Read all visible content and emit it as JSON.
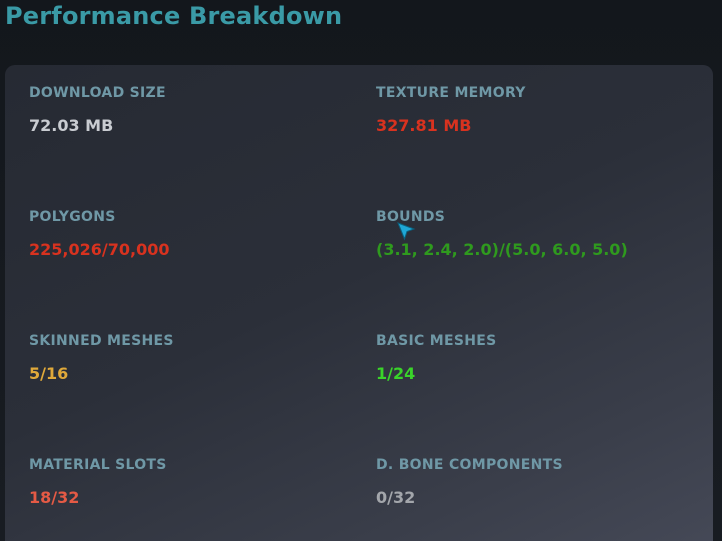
{
  "header": {
    "title": "Performance Breakdown"
  },
  "stats": [
    {
      "label": "DOWNLOAD SIZE",
      "value": "72.03 MB",
      "color": "#c9ccd1"
    },
    {
      "label": "TEXTURE MEMORY",
      "value": "327.81 MB",
      "color": "#d8321f"
    },
    {
      "label": "POLYGONS",
      "value": "225,026/70,000",
      "color": "#d8321f"
    },
    {
      "label": "BOUNDS",
      "value": "(3.1, 2.4, 2.0)/(5.0, 6.0, 5.0)",
      "color": "#2f9a1e"
    },
    {
      "label": "SKINNED MESHES",
      "value": "5/16",
      "color": "#e0a93a"
    },
    {
      "label": "BASIC MESHES",
      "value": "1/24",
      "color": "#3ad42a"
    },
    {
      "label": "MATERIAL SLOTS",
      "value": "18/32",
      "color": "#e45a45"
    },
    {
      "label": "D. BONE COMPONENTS",
      "value": "0/32",
      "color": "#a3a6ab"
    }
  ],
  "colors": {
    "title": "#3a9aa6",
    "label": "#6f98a6",
    "cursor": "#1fa7d6"
  },
  "icons": {
    "cursor": "pointer-arrow-icon"
  }
}
